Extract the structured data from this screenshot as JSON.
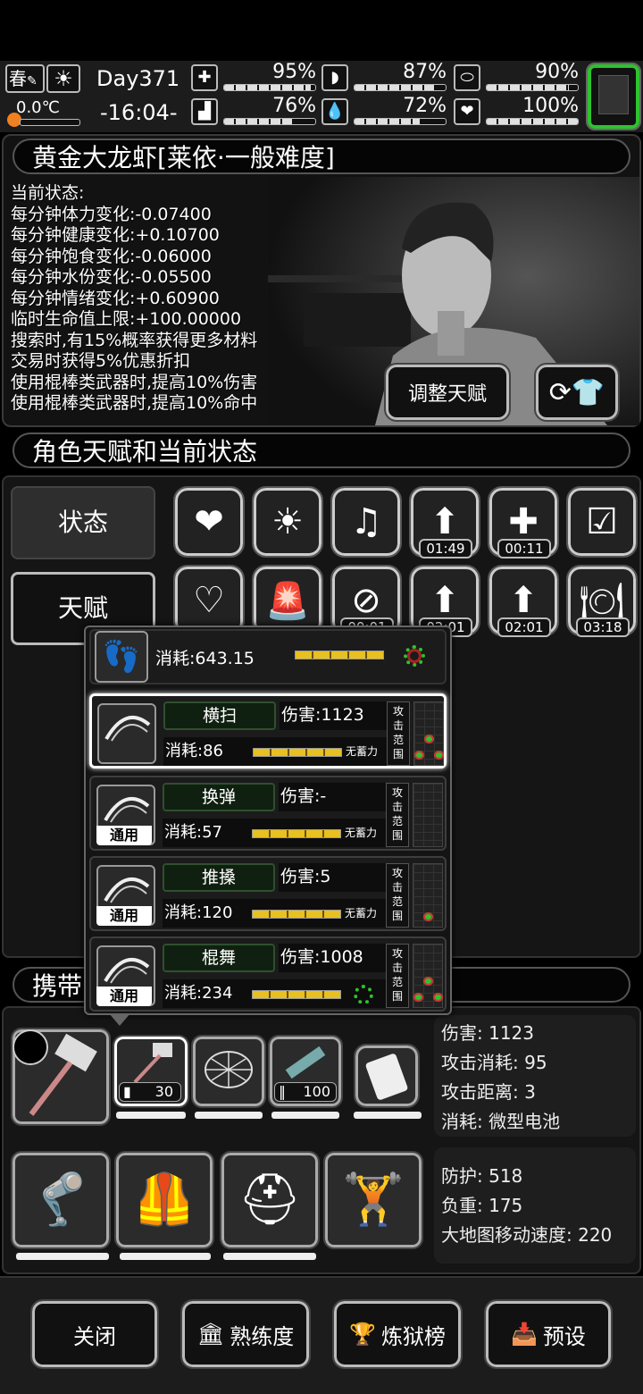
{
  "hud": {
    "season": "春",
    "temperature": "0.0℃",
    "day": "Day371",
    "time": "-16:04-",
    "stats": [
      {
        "name": "health-kit",
        "value": "95%",
        "pct": 95
      },
      {
        "name": "stomach",
        "value": "87%",
        "pct": 87
      },
      {
        "name": "pill",
        "value": "90%",
        "pct": 90
      },
      {
        "name": "boot",
        "value": "76%",
        "pct": 76
      },
      {
        "name": "water-drop",
        "value": "72%",
        "pct": 72
      },
      {
        "name": "heart-hand",
        "value": "100%",
        "pct": 100
      }
    ]
  },
  "character": {
    "title": "黄金大龙虾[莱依·一般难度]",
    "status_lines": [
      "当前状态:",
      "每分钟体力变化:-0.07400",
      "每分钟健康变化:+0.10700",
      "每分钟饱食变化:-0.06000",
      "每分钟水份变化:-0.05500",
      "每分钟情绪变化:+0.60900",
      "临时生命值上限:+100.00000",
      "搜索时,有15%概率获得更多材料",
      "交易时获得5%优惠折扣",
      "使用棍棒类武器时,提高10%伤害",
      "使用棍棒类武器时,提高10%命中"
    ],
    "adjust_talent": "调整天赋"
  },
  "section_talent": "角色天赋和当前状态",
  "tabs": {
    "status": "状态",
    "talent": "天赋"
  },
  "buffs": {
    "row1": [
      "heart",
      "sun",
      "music-heart",
      "medkit-up",
      "pill-plus",
      "checklist-pill"
    ],
    "timers1": [
      "",
      "",
      "",
      "01:49",
      "00:11",
      ""
    ],
    "row2": [
      "stomach-heart",
      "alarm-person",
      "person-no",
      "bottle-up",
      "syringe-up",
      "plate-heart"
    ],
    "timers2": [
      "",
      "",
      "00:01",
      "02:01",
      "02:01",
      "03:18"
    ]
  },
  "popup": {
    "walk_cost": "消耗:643.15",
    "skills": [
      {
        "name": "横扫",
        "damage": "伤害:1123",
        "cost": "消耗:86",
        "charge": "无蓄力",
        "tag": ""
      },
      {
        "name": "换弹",
        "damage": "伤害:-",
        "cost": "消耗:57",
        "charge": "无蓄力",
        "tag": "通用"
      },
      {
        "name": "推搡",
        "damage": "伤害:5",
        "cost": "消耗:120",
        "charge": "无蓄力",
        "tag": "通用"
      },
      {
        "name": "棍舞",
        "damage": "伤害:1008",
        "cost": "消耗:234",
        "charge": "",
        "tag": "通用"
      }
    ],
    "range_label": "攻击范围"
  },
  "carry_title": "携带",
  "weapon": {
    "ammo1": "30",
    "ammo2": "100",
    "stats": [
      "伤害: 1123",
      "攻击消耗: 95",
      "攻击距离: 3",
      "消耗: 微型电池"
    ]
  },
  "armor": {
    "stats": [
      "防护: 518",
      "负重: 175",
      "大地图移动速度: 220"
    ]
  },
  "bottom": {
    "close": "关闭",
    "mastery": "熟练度",
    "ranking": "炼狱榜",
    "preset": "预设"
  },
  "colors": {
    "accent_green": "#2ec22e",
    "charge_yellow": "#e8c020"
  }
}
